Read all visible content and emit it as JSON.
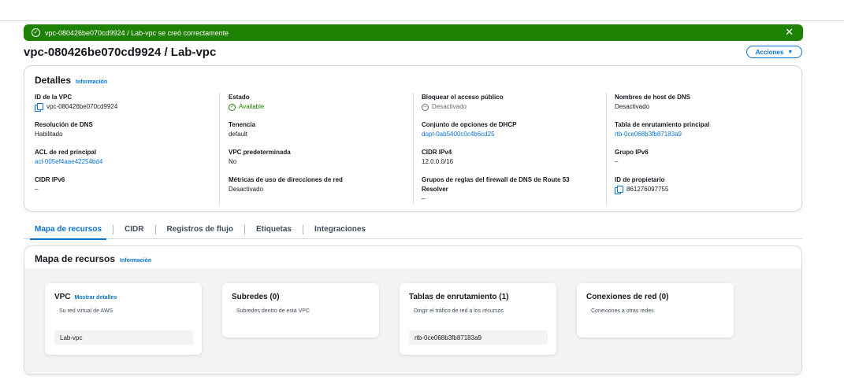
{
  "flash": {
    "message": "vpc-080426be070cd9924 / Lab-vpc se creó correctamente",
    "close": "✕"
  },
  "header": {
    "title": "vpc-080426be070cd9924 / Lab-vpc",
    "actions_label": "Acciones",
    "actions_caret": "▼"
  },
  "details": {
    "title": "Detalles",
    "info": "Información",
    "columns": [
      [
        {
          "label": "ID de la VPC",
          "value": "vpc-080426be070cd9924"
        },
        {
          "label": "Resolución de DNS",
          "value": "Habilitado"
        },
        {
          "label": "ACL de red principal",
          "value": "acl-005ef4aae42254bd4"
        },
        {
          "label": "CIDR IPv6",
          "value": "–"
        }
      ],
      [
        {
          "label": "Estado",
          "value": "Available"
        },
        {
          "label": "Tenencia",
          "value": "default"
        },
        {
          "label": "VPC predeterminada",
          "value": "No"
        },
        {
          "label": "Métricas de uso de direcciones de red",
          "value": "Desactivado"
        }
      ],
      [
        {
          "label": "Bloquear el acceso público",
          "value": "Desactivado"
        },
        {
          "label": "Conjunto de opciones de DHCP",
          "value": "dopt-0ab5400c0c4b6cd25"
        },
        {
          "label": "CIDR IPv4",
          "value": "12.0.0.0/16"
        },
        {
          "label": "Grupos de reglas del firewall de DNS de Route 53 Resolver",
          "label_line1": "Grupos de reglas del firewall de DNS de Route 53",
          "label_line2": "Resolver",
          "value": "–"
        }
      ],
      [
        {
          "label": "Nombres de host de DNS",
          "value": "Desactivado"
        },
        {
          "label": "Tabla de enrutamiento principal",
          "value": "rtb-0ce068b3fb87183a9"
        },
        {
          "label": "Grupo IPv6",
          "value": "–"
        },
        {
          "label": "ID de propietario",
          "value": "861276097755"
        }
      ]
    ]
  },
  "tabs": [
    {
      "label": "Mapa de recursos",
      "active": true
    },
    {
      "label": "CIDR",
      "active": false
    },
    {
      "label": "Registros de flujo",
      "active": false
    },
    {
      "label": "Etiquetas",
      "active": false
    },
    {
      "label": "Integraciones",
      "active": false
    }
  ],
  "resource_map": {
    "title": "Mapa de recursos",
    "info": "Información",
    "cards": [
      {
        "title": "VPC",
        "link": "Mostrar detalles",
        "subtitle": "Su red virtual de AWS",
        "chip": "Lab-vpc"
      },
      {
        "title": "Subredes (0)",
        "subtitle": "Subredes dentro de esta VPC"
      },
      {
        "title": "Tablas de enrutamiento (1)",
        "subtitle": "Dirigir el tráfico de red a los recursos",
        "chip": "rtb-0ce068b3fb87183a9"
      },
      {
        "title": "Conexiones de red (0)",
        "subtitle": "Conexiones a otras redes"
      }
    ]
  },
  "colors": {
    "success": "#1d8102",
    "link": "#0972d3",
    "text": "#16191f",
    "muted": "#5f6b7a"
  },
  "icons": [
    "check-circle-icon",
    "close-icon",
    "caret-down-icon",
    "copy-icon",
    "status-available-icon",
    "status-disabled-icon"
  ]
}
